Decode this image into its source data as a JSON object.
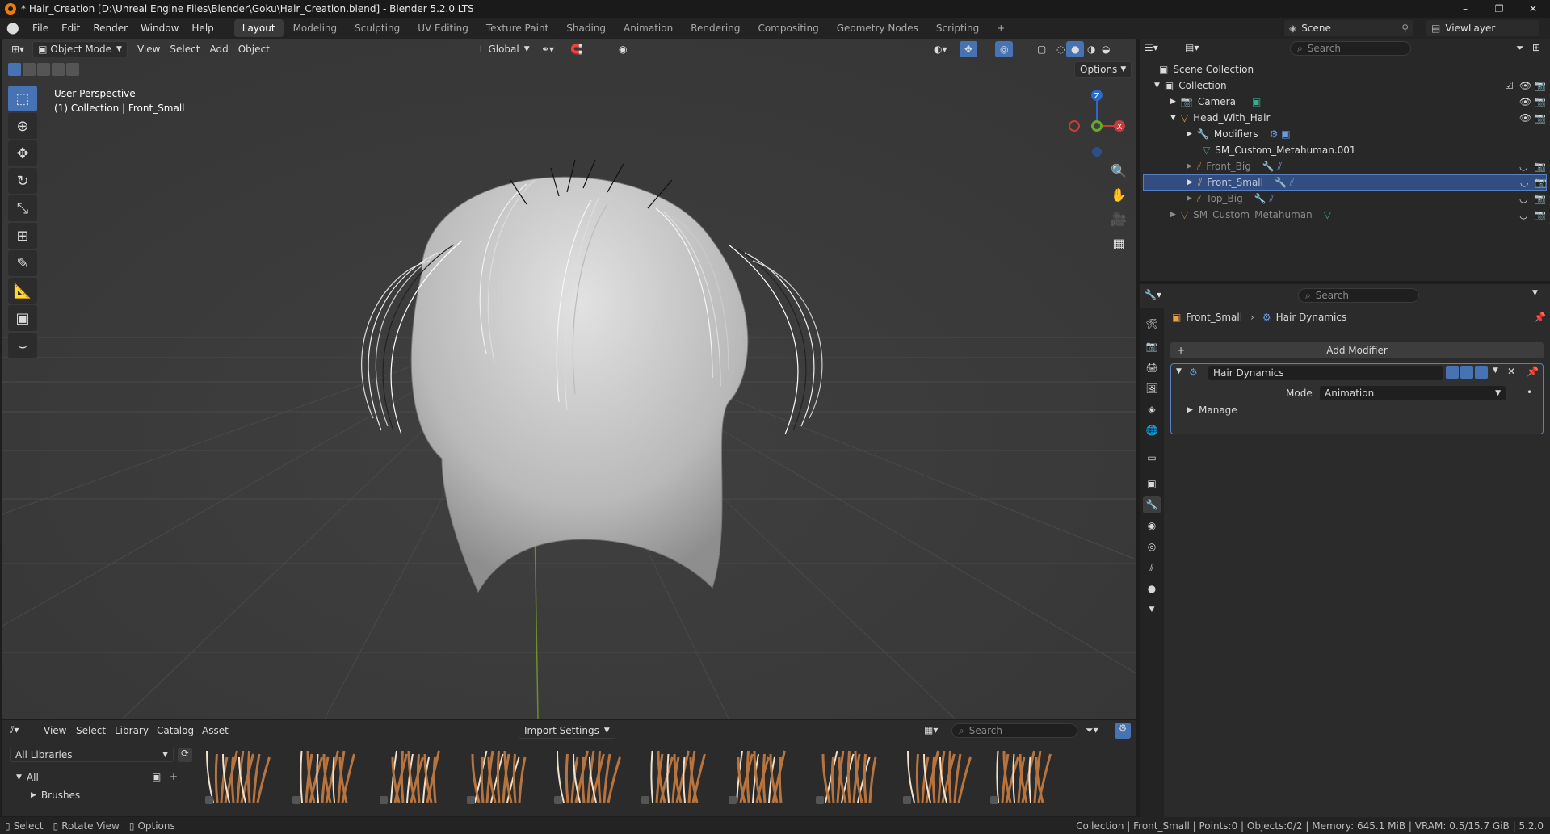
{
  "window": {
    "title": "* Hair_Creation [D:\\Unreal Engine Files\\Blender\\Goku\\Hair_Creation.blend] - Blender 5.2.0 LTS",
    "minimize": "–",
    "maximize": "❐",
    "close": "✕"
  },
  "menu": [
    "File",
    "Edit",
    "Render",
    "Window",
    "Help"
  ],
  "workspaces": [
    "Layout",
    "Modeling",
    "Sculpting",
    "UV Editing",
    "Texture Paint",
    "Shading",
    "Animation",
    "Rendering",
    "Compositing",
    "Geometry Nodes",
    "Scripting"
  ],
  "active_workspace": "Layout",
  "add_workspace": "+",
  "scene": {
    "name": "Scene",
    "view_layer": "ViewLayer"
  },
  "viewport": {
    "mode": "Object Mode",
    "menus": [
      "View",
      "Select",
      "Add",
      "Object"
    ],
    "transform_orientation": "Global",
    "options_label": "Options",
    "perspective_label": "User Perspective",
    "collection_label": "(1) Collection | Front_Small",
    "gizmo": {
      "z": "Z",
      "x": "X",
      "y": "Y"
    }
  },
  "outliner": {
    "search_placeholder": "Search",
    "rows": [
      {
        "label": "Scene Collection",
        "level": 0
      },
      {
        "label": "Collection",
        "level": 1
      },
      {
        "label": "Camera",
        "level": 2
      },
      {
        "label": "Head_With_Hair",
        "level": 2
      },
      {
        "label": "Modifiers",
        "level": 3
      },
      {
        "label": "SM_Custom_Metahuman.001",
        "level": 3
      },
      {
        "label": "Front_Big",
        "level": 3
      },
      {
        "label": "Front_Small",
        "level": 3
      },
      {
        "label": "Top_Big",
        "level": 3
      },
      {
        "label": "SM_Custom_Metahuman",
        "level": 2
      }
    ],
    "selected": "Front_Small"
  },
  "properties": {
    "search_placeholder": "Search",
    "breadcrumb_object": "Front_Small",
    "breadcrumb_modifier": "Hair Dynamics",
    "add_modifier_label": "Add Modifier",
    "modifier_name": "Hair Dynamics",
    "mode_label": "Mode",
    "mode_value": "Animation",
    "manage_label": "Manage"
  },
  "assets": {
    "menus": [
      "View",
      "Select",
      "Library",
      "Catalog",
      "Asset"
    ],
    "import_settings": "Import Settings",
    "search_placeholder": "Search",
    "library": "All Libraries",
    "tree_all": "All",
    "tree_brushes": "Brushes",
    "thumb_count": 10
  },
  "status": {
    "select": "Select",
    "rotate_view": "Rotate View",
    "options": "Options",
    "stats": "Collection | Front_Small | Points:0 | Objects:0/2 | Memory: 645.1 MiB | VRAM: 0.5/15.7 GiB | 5.2.0"
  }
}
